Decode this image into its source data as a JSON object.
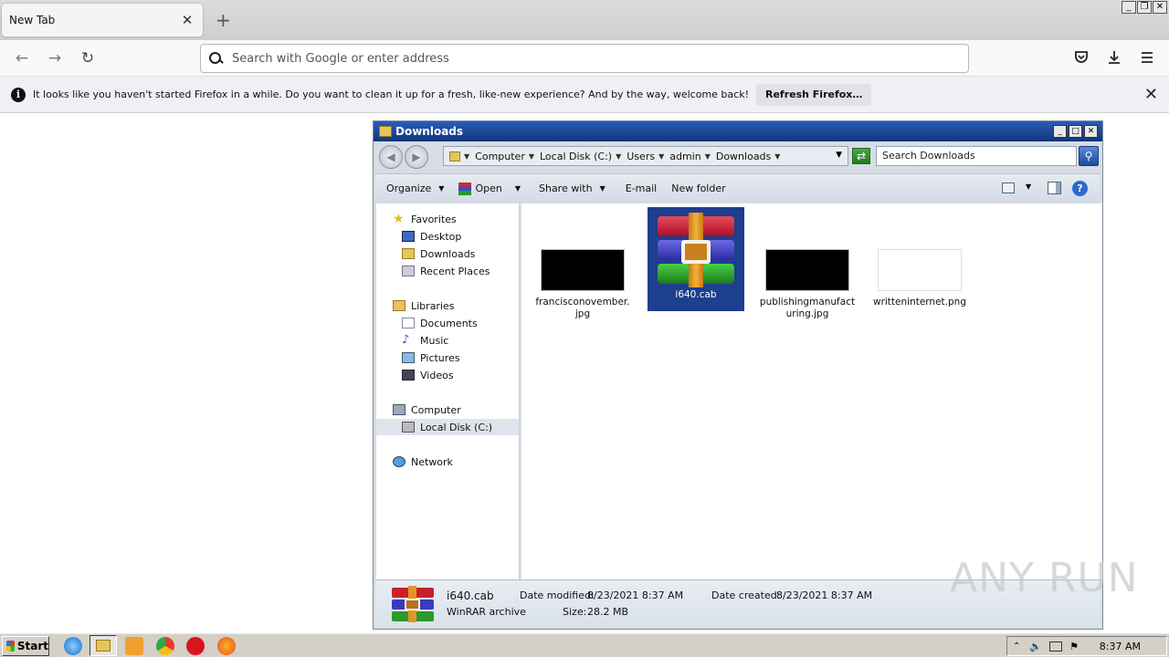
{
  "browser": {
    "tab_title": "New Tab",
    "tab_close": "✕",
    "new_tab": "+",
    "url_placeholder": "Search with Google or enter address",
    "nav_back": "←",
    "nav_forward": "→",
    "nav_reload": "↻",
    "toolbar_icons": [
      "pocket-icon",
      "downloads-icon",
      "menu-icon"
    ],
    "window_controls": [
      "_",
      "❐",
      "✕"
    ]
  },
  "notification": {
    "text": "It looks like you haven't started Firefox in a while. Do you want to clean it up for a fresh, like-new experience? And by the way, welcome back!",
    "button": "Refresh Firefox…",
    "close": "✕"
  },
  "explorer": {
    "title": "Downloads",
    "window_controls": [
      "_",
      "□",
      "✕"
    ],
    "breadcrumbs": [
      "Computer",
      "Local Disk (C:)",
      "Users",
      "admin",
      "Downloads"
    ],
    "search_placeholder": "Search Downloads",
    "commands": {
      "organize": "Organize",
      "open": "Open",
      "share_with": "Share with",
      "email": "E-mail",
      "new_folder": "New folder"
    },
    "nav": {
      "favorites": "Favorites",
      "desktop": "Desktop",
      "downloads": "Downloads",
      "recent_places": "Recent Places",
      "libraries": "Libraries",
      "documents": "Documents",
      "music": "Music",
      "pictures": "Pictures",
      "videos": "Videos",
      "computer": "Computer",
      "local_disk": "Local Disk (C:)",
      "network": "Network"
    },
    "files": [
      {
        "name": "francisconovember.jpg",
        "type": "jpg"
      },
      {
        "name": "i640.cab",
        "type": "cab",
        "selected": true
      },
      {
        "name": "publishingmanufacturing.jpg",
        "type": "jpg"
      },
      {
        "name": "writteninternet.png",
        "type": "png"
      }
    ],
    "details": {
      "name": "i640.cab",
      "type": "WinRAR archive",
      "modified_label": "Date modified:",
      "modified": "8/23/2021 8:37 AM",
      "size_label": "Size:",
      "size": "28.2 MB",
      "created_label": "Date created:",
      "created": "8/23/2021 8:37 AM"
    }
  },
  "watermark": "ANY RUN",
  "taskbar": {
    "start": "Start",
    "clock": "8:37 AM"
  }
}
